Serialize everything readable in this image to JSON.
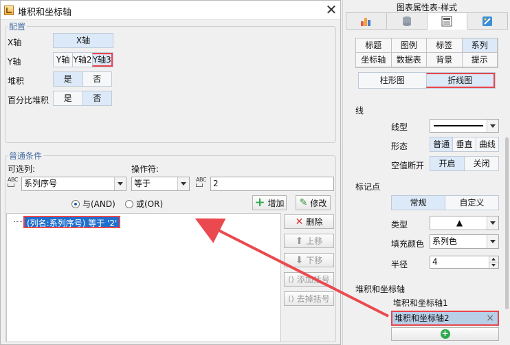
{
  "dialog": {
    "title": "堆积和坐标轴",
    "close_glyph": "✕",
    "config": {
      "legend": "配置",
      "x_label": "X轴",
      "x_value": "X轴",
      "y_label": "Y轴",
      "y_options": [
        "Y轴",
        "Y轴2",
        "Y轴3"
      ],
      "stack_label": "堆积",
      "stack_yes": "是",
      "stack_no": "否",
      "pct_label": "百分比堆积",
      "pct_yes": "是",
      "pct_no": "否"
    },
    "conditions": {
      "legend": "普通条件",
      "col_label": "可选列:",
      "op_label": "操作符:",
      "col_value": "系列序号",
      "op_value": "等于",
      "abc": "ABC",
      "value": "2",
      "and_label": "与(AND)",
      "or_label": "或(OR)",
      "add_label": "增加",
      "edit_label": "修改",
      "tree_item": "(列名:系列序号) 等于 '2'",
      "delete_label": "删除",
      "up_label": "上移",
      "down_label": "下移",
      "add_paren_label": "添加括号",
      "remove_paren_label": "去掉括号"
    }
  },
  "panel": {
    "title": "图表属性表-样式",
    "sub_tabs_row1": [
      "标题",
      "图例",
      "标签",
      "系列"
    ],
    "sub_tabs_row2": [
      "坐标轴",
      "数据表",
      "背景",
      "提示"
    ],
    "chart_type_bar": "柱形图",
    "chart_type_line": "折线图",
    "line_section": "线",
    "line_type_label": "线型",
    "shape_label": "形态",
    "shape_options": [
      "普通",
      "垂直",
      "曲线"
    ],
    "null_label": "空值断开",
    "null_on": "开启",
    "null_off": "关闭",
    "marker_section": "标记点",
    "marker_normal": "常规",
    "marker_custom": "自定义",
    "type_label": "类型",
    "type_value": "▲",
    "fill_label": "填充颜色",
    "fill_value": "系列色",
    "radius_label": "半径",
    "radius_value": "4",
    "stack_section": "堆积和坐标轴",
    "stack_items": [
      "堆积和坐标轴1",
      "堆积和坐标轴2"
    ],
    "remove_glyph": "×",
    "add_glyph": "+"
  },
  "colors": {
    "highlight_red": "#e8454b",
    "selection_blue": "#1f6fce",
    "toggle_on": "#dce9f8",
    "add_green": "#2fa84f"
  }
}
